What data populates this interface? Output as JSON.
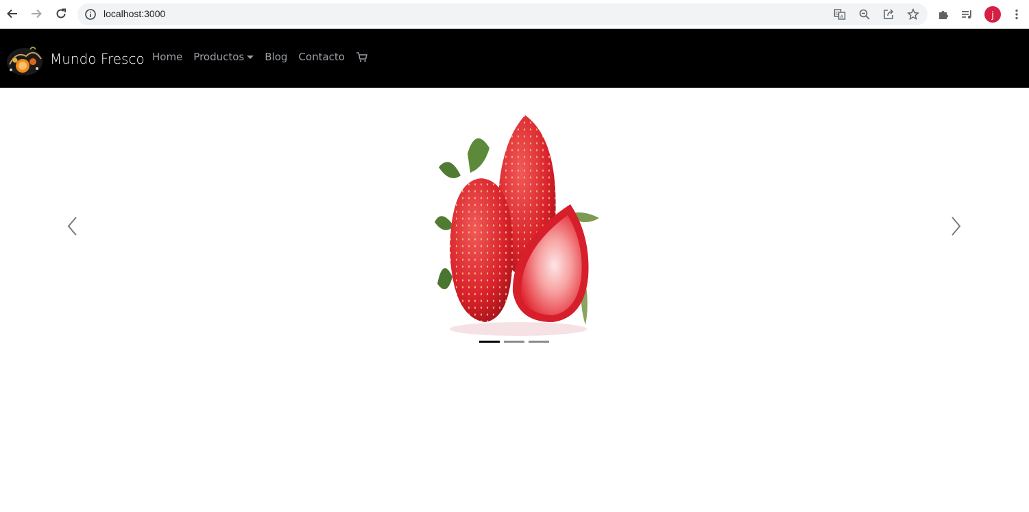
{
  "browser": {
    "url": "localhost:3000",
    "profile_initial": "j",
    "profile_color": "#d61f45",
    "icons": {
      "back": "back-arrow-icon",
      "forward": "forward-arrow-icon",
      "reload": "reload-icon",
      "info": "info-icon",
      "translate": "translate-icon",
      "zoom": "zoom-out-icon",
      "share": "share-icon",
      "bookmark": "star-icon",
      "extensions": "puzzle-icon",
      "media": "media-queue-icon",
      "menu": "kebab-menu-icon"
    }
  },
  "navbar": {
    "brand": "Mundo Fresco",
    "links": [
      {
        "label": "Home"
      },
      {
        "label": "Productos",
        "dropdown": true
      },
      {
        "label": "Blog"
      },
      {
        "label": "Contacto"
      }
    ],
    "cart_icon": "cart-icon",
    "background": "#000000",
    "link_color": "#9aa0a6"
  },
  "carousel": {
    "slide_image": "strawberries",
    "active_index": 0,
    "indicators": 3,
    "active_color": "#000000",
    "inactive_color": "#8a8a8a"
  }
}
